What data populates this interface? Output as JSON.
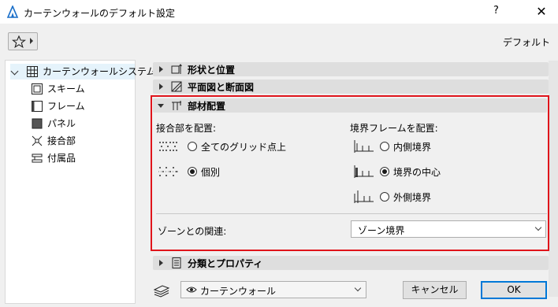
{
  "window": {
    "title": "カーテンウォールのデフォルト設定",
    "help": "?",
    "close": "✕"
  },
  "toolbar": {
    "favorites_icon": "star-icon",
    "default_label": "デフォルト"
  },
  "tree": {
    "root": "カーテンウォールシステム",
    "items": [
      {
        "label": "スキーム",
        "icon": "scheme-icon"
      },
      {
        "label": "フレーム",
        "icon": "frame-icon"
      },
      {
        "label": "パネル",
        "icon": "panel-icon"
      },
      {
        "label": "接合部",
        "icon": "junction-icon"
      },
      {
        "label": "付属品",
        "icon": "accessory-icon"
      }
    ]
  },
  "sections": {
    "shape": "形状と位置",
    "plan": "平面図と断面図",
    "members": "部材配置",
    "classification": "分類とプロパティ"
  },
  "members": {
    "junction_label": "接合部を配置:",
    "junction_options": [
      "全てのグリッド点上",
      "個別"
    ],
    "junction_selected": 1,
    "boundary_label": "境界フレームを配置:",
    "boundary_options": [
      "内側境界",
      "境界の中心",
      "外側境界"
    ],
    "boundary_selected": 1,
    "zone_label": "ゾーンとの関連:",
    "zone_value": "ゾーン境界"
  },
  "bottom": {
    "view_value": "カーテンウォール",
    "cancel": "キャンセル",
    "ok": "OK"
  },
  "colors": {
    "highlight_border": "#e0141b",
    "ok_border": "#0078d7"
  }
}
